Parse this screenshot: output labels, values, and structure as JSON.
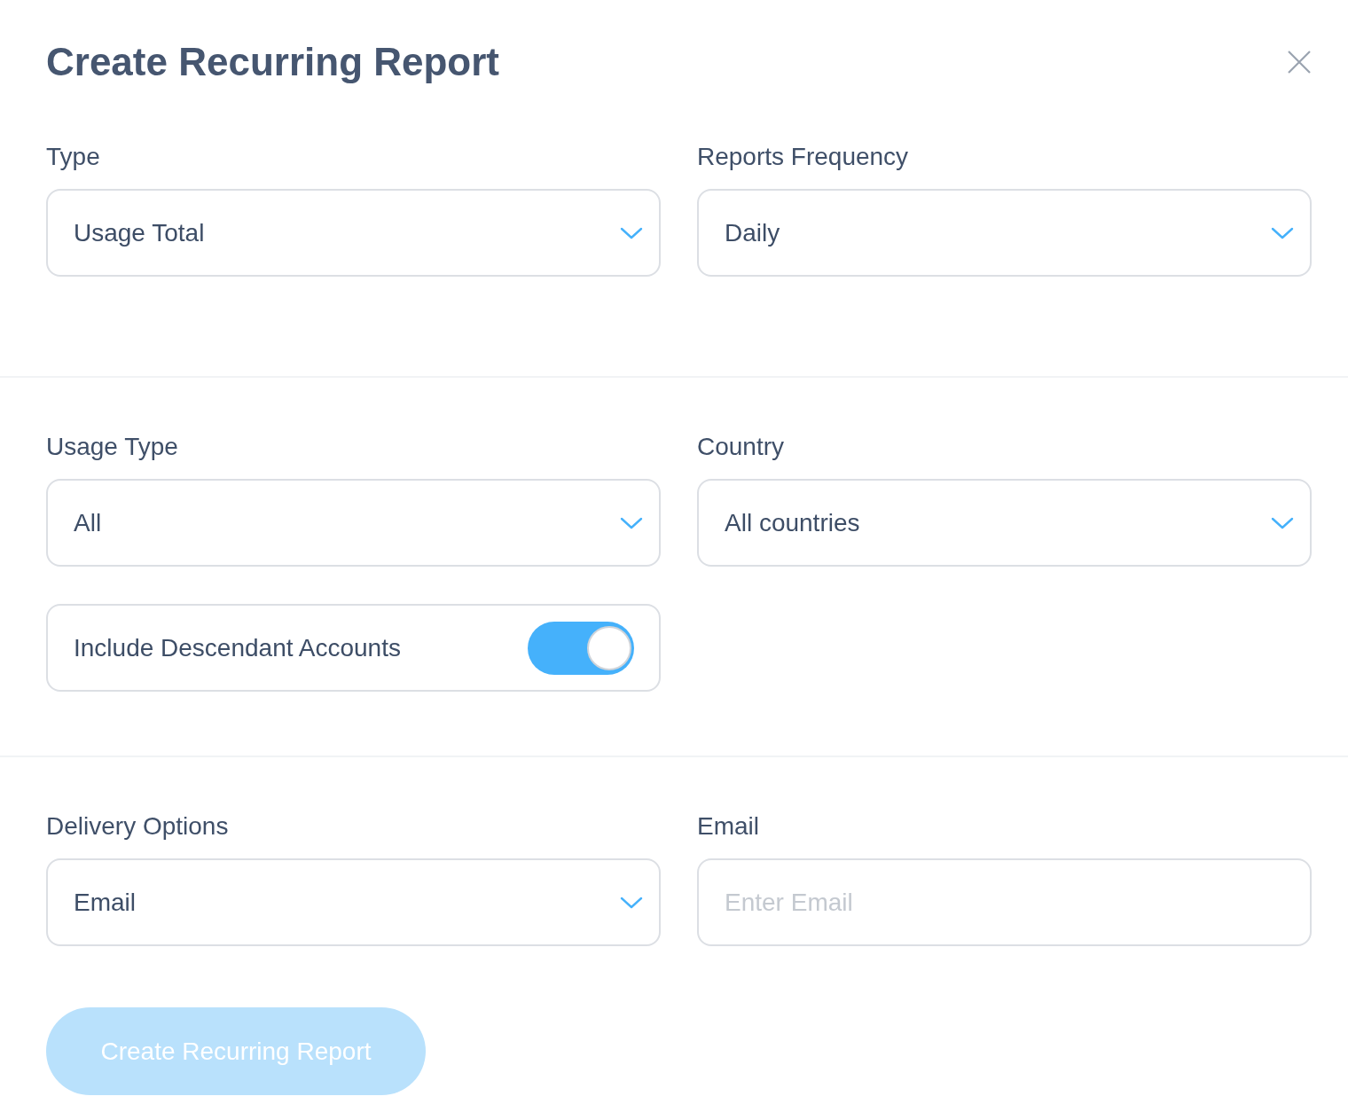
{
  "dialog": {
    "title": "Create Recurring Report"
  },
  "sections": [
    {
      "fields": [
        {
          "kind": "select",
          "label": "Type",
          "value": "Usage Total"
        },
        {
          "kind": "select",
          "label": "Reports Frequency",
          "value": "Daily"
        }
      ]
    },
    {
      "fields": [
        {
          "kind": "select",
          "label": "Usage Type",
          "value": "All"
        },
        {
          "kind": "select",
          "label": "Country",
          "value": "All countries"
        },
        {
          "kind": "toggle",
          "label": "Include Descendant Accounts",
          "on": true
        }
      ]
    },
    {
      "fields": [
        {
          "kind": "select",
          "label": "Delivery Options",
          "value": "Email"
        },
        {
          "kind": "input",
          "label": "Email",
          "placeholder": "Enter Email"
        }
      ]
    }
  ],
  "submit_button": {
    "label": "Create Recurring Report",
    "disabled": true
  }
}
